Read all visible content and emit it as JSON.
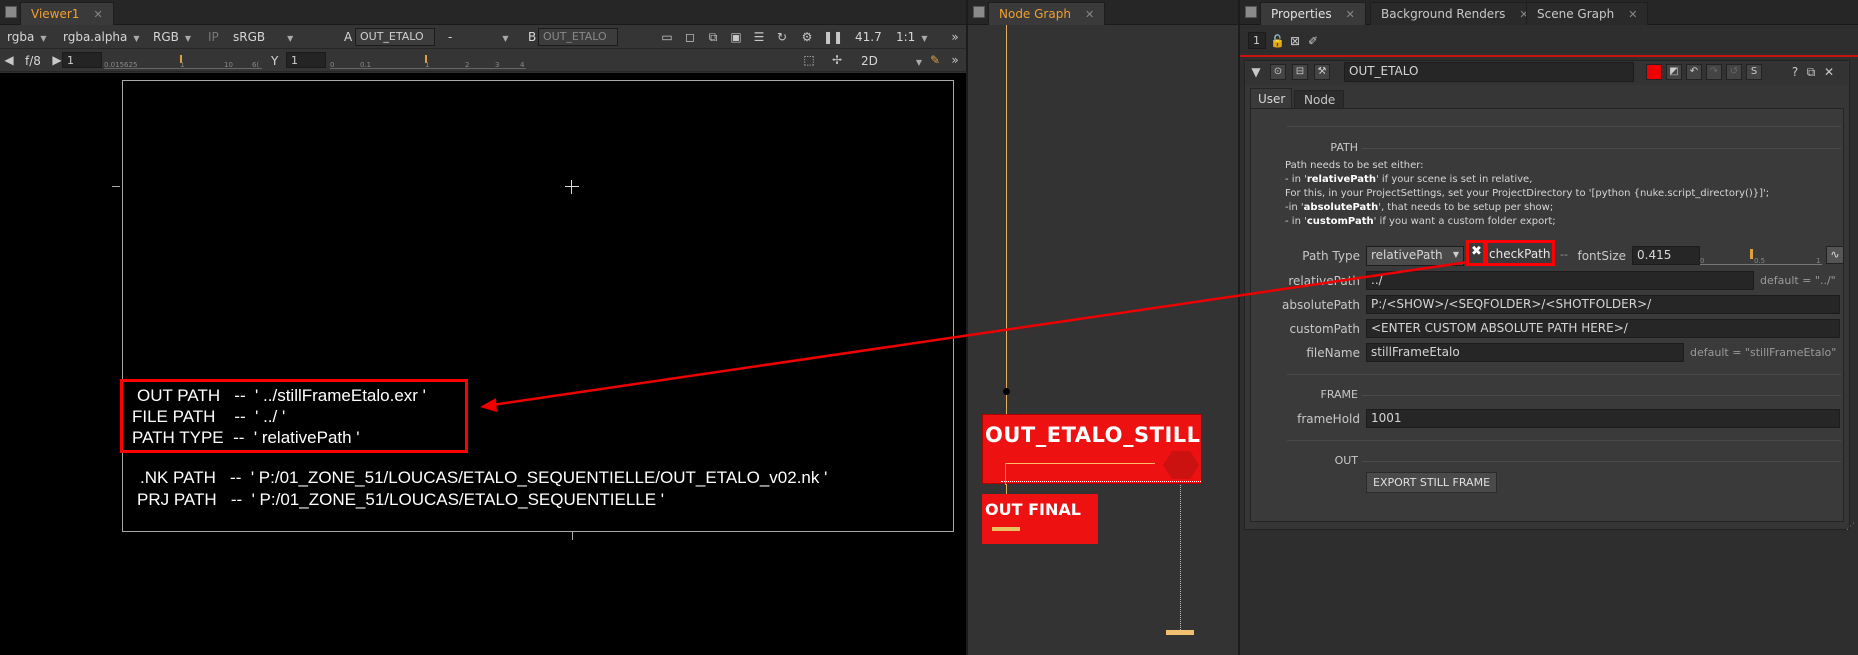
{
  "viewer": {
    "tab_label": "Viewer1",
    "tab_close": "✕",
    "channels": "rgba",
    "channel_alpha": "rgba.alpha",
    "display": "RGB",
    "ip_label": "IP",
    "colorspace": "sRGB",
    "input_a_label": "A",
    "input_a_value": "OUT_ETALO",
    "input_dash": "-",
    "input_b_label": "B",
    "input_b_value": "OUT_ETALO",
    "zoom": "41.7",
    "ratio": "1:1",
    "fstop": "f/8",
    "gain_value": "1",
    "gain_ticks": [
      "0.015625",
      "1",
      "10",
      "6("
    ],
    "gamma_label": "Y",
    "gamma_value": "1",
    "gamma_ticks": [
      "0",
      "0.1",
      "1",
      "2",
      "3",
      "4"
    ],
    "view_mode": "2D",
    "overlay": {
      "out_path": "OUT PATH   --  ' ../stillFrameEtalo.exr '",
      "file_path": "FILE PATH    --  ' ../ '",
      "path_type": "PATH TYPE  --  ' relativePath '",
      "nk_path": ".NK PATH   --  ' P:/01_ZONE_51/LOUCAS/ETALO_SEQUENTIELLE/OUT_ETALO_v02.nk '",
      "prj_path": "PRJ PATH   --  ' P:/01_ZONE_51/LOUCAS/ETALO_SEQUENTIELLE '"
    }
  },
  "node_graph": {
    "tab_label": "Node Graph",
    "tab_close": "✕",
    "group_node_label": "OUT_ETALO_STILL",
    "final_node_label": "OUT FINAL"
  },
  "properties": {
    "tabs": [
      {
        "label": "Properties",
        "close": "✕"
      },
      {
        "label": "Background Renders",
        "close": "✕"
      },
      {
        "label": "Scene Graph",
        "close": "✕"
      }
    ],
    "max_panels": "1",
    "node_name": "OUT_ETALO",
    "sub_tabs": [
      "User",
      "Node"
    ],
    "sections": {
      "path": "PATH",
      "frame": "FRAME",
      "out": "OUT"
    },
    "description": {
      "line1": "Path needs to be set either:",
      "line2_pre": "- in '",
      "line2_bold": "relativePath",
      "line2_post": "' if your scene is set in relative,",
      "line3": "For this, in your ProjectSettings, set your ProjectDirectory to '[python {nuke.script_directory()}]';",
      "line4_pre": "-in '",
      "line4_bold": "absolutePath",
      "line4_post": "', that needs to be setup per show;",
      "line5_pre": "- in '",
      "line5_bold": "customPath",
      "line5_post": "' if you want a custom folder export;"
    },
    "knobs": {
      "path_type_label": "Path Type",
      "path_type_value": "relativePath",
      "check_path_label": "checkPath",
      "font_size_label": "fontSize",
      "font_size_value": "0.415",
      "font_ticks": [
        "0",
        "0.5",
        "1"
      ],
      "relative_path_label": "relativePath",
      "relative_path_value": "../",
      "relative_path_default": "default = \"../\"",
      "absolute_path_label": "absolutePath",
      "absolute_path_value": "P:/<SHOW>/<SEQFOLDER>/<SHOTFOLDER>/",
      "custom_path_label": "customPath",
      "custom_path_value": "<ENTER CUSTOM ABSOLUTE PATH HERE>/",
      "file_name_label": "fileName",
      "file_name_value": "stillFrameEtalo",
      "file_name_default": "default = \"stillFrameEtalo\"",
      "frame_hold_label": "frameHold",
      "frame_hold_value": "1001",
      "export_button": "EXPORT STILL FRAME"
    }
  },
  "colors": {
    "accent_orange": "#f0a030",
    "annotation_red": "#ff0000",
    "node_red": "#ff1010"
  }
}
